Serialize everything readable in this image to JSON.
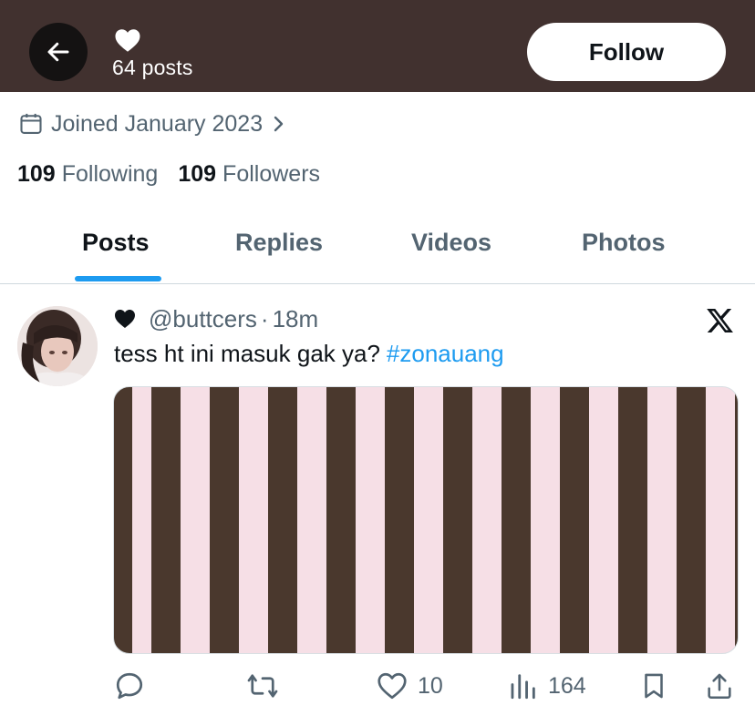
{
  "header": {
    "post_count": "64 posts",
    "follow_label": "Follow",
    "bg_color": "#41312f"
  },
  "profile": {
    "joined": "Joined January 2023",
    "following_count": "109",
    "following_label": "Following",
    "followers_count": "109",
    "followers_label": "Followers"
  },
  "tabs": [
    {
      "label": "Posts",
      "active": true
    },
    {
      "label": "Replies",
      "active": false
    },
    {
      "label": "Videos",
      "active": false
    },
    {
      "label": "Photos",
      "active": false
    }
  ],
  "post": {
    "handle": "@buttcers",
    "separator": "·",
    "time": "18m",
    "text": "tess ht ini masuk gak ya?",
    "hashtag": "#zonauang",
    "media_colors": [
      "#f6dfe6",
      "#4a382d"
    ],
    "likes": "10",
    "views": "164"
  },
  "icons": [
    "back-arrow-icon",
    "heart-icon",
    "calendar-icon",
    "chevron-right-icon",
    "x-logo-icon",
    "reply-icon",
    "repost-icon",
    "like-icon",
    "views-icon",
    "bookmark-icon",
    "share-icon"
  ],
  "accent": "#1d9bf0"
}
